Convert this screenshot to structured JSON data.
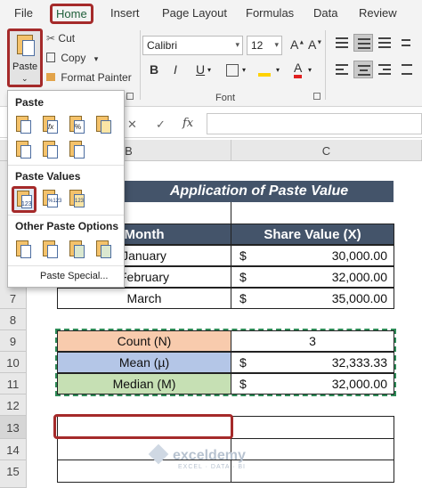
{
  "ribbon": {
    "tabs": [
      "File",
      "Home",
      "Insert",
      "Page Layout",
      "Formulas",
      "Data",
      "Review"
    ],
    "paste_label": "Paste",
    "cut_label": "Cut",
    "copy_label": "Copy",
    "format_painter_label": "Format Painter",
    "font_name": "Calibri",
    "font_size": "12",
    "font_group_label": "Font",
    "bold": "B",
    "italic": "I",
    "underline": "U",
    "font_color_letter": "A"
  },
  "formula_bar": {
    "fx": "fx",
    "cancel": "✕",
    "enter": "✓"
  },
  "paste_menu": {
    "paste_heading": "Paste",
    "paste_values_heading": "Paste Values",
    "other_heading": "Other Paste Options",
    "paste_special": "Paste Special..."
  },
  "grid": {
    "columns": [
      "B",
      "C"
    ],
    "rows": [
      "7",
      "8",
      "9",
      "10",
      "11",
      "12",
      "13",
      "14",
      "15"
    ],
    "title": "Application of Paste Value",
    "headers": {
      "month": "Month",
      "share": "Share Value (X)"
    },
    "data_rows": [
      {
        "month": "January",
        "currency": "$",
        "value": "30,000.00"
      },
      {
        "month": "February",
        "currency": "$",
        "value": "32,000.00"
      },
      {
        "month": "March",
        "currency": "$",
        "value": "35,000.00"
      }
    ],
    "stats": [
      {
        "label": "Count (N)",
        "currency": "",
        "value": "3"
      },
      {
        "label": "Mean (µ)",
        "currency": "$",
        "value": "32,333.33"
      },
      {
        "label": "Median (M)",
        "currency": "$",
        "value": "32,000.00"
      }
    ]
  },
  "watermark": {
    "name": "exceldemy",
    "tagline": "EXCEL · DATA · BI"
  },
  "colors": {
    "title_band": "#44546a",
    "count_fill": "#f8cbad",
    "mean_fill": "#b4c6e7",
    "median_fill": "#c6e0b4",
    "highlight": "#a52a2a"
  }
}
